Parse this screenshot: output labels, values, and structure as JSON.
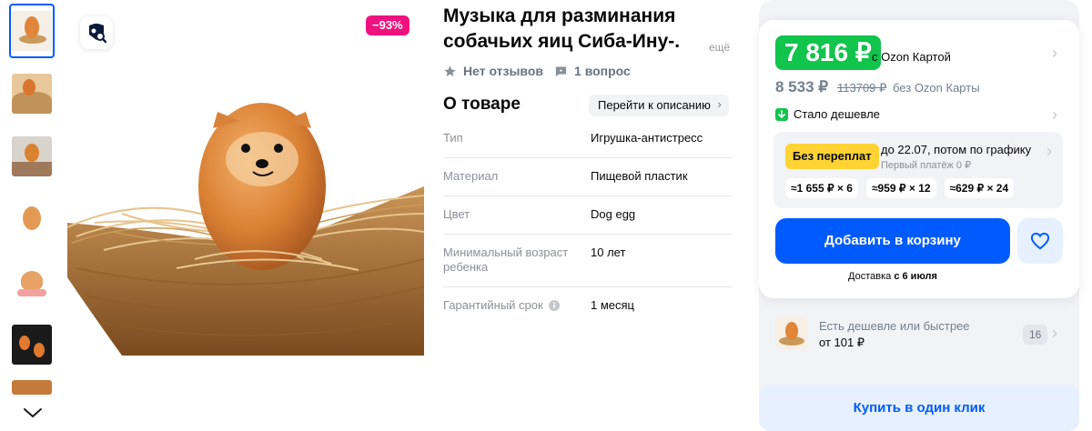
{
  "gallery": {
    "thumbnails": [
      "thumb-1",
      "thumb-2",
      "thumb-3",
      "thumb-4",
      "thumb-5",
      "thumb-6",
      "thumb-7"
    ],
    "discount": "−93%"
  },
  "product": {
    "title_line1": "Музыка для разминания",
    "title_line2": "собачьих яиц Сиба-Ину-.",
    "more": "ещё",
    "reviews": "Нет отзывов",
    "questions": "1 вопрос"
  },
  "about": {
    "heading": "О товаре",
    "goto_description": "Перейти к описанию",
    "specs": [
      {
        "key": "Тип",
        "value": "Игрушка-антистресс"
      },
      {
        "key": "Материал",
        "value": "Пищевой пластик"
      },
      {
        "key": "Цвет",
        "value": "Dog egg"
      },
      {
        "key": "Минимальный возраст ребенка",
        "value": "10 лет"
      },
      {
        "key": "Гарантийный срок",
        "value": "1 месяц"
      }
    ]
  },
  "buybox": {
    "price_card": "7 816 ₽",
    "with_card_label": "с Ozon Картой",
    "price": "8 533 ₽",
    "price_old": "113709 ₽",
    "without_card_label": "без Ozon Карты",
    "cheaper_label": "Стало дешевле",
    "no_overpay_badge": "Без переплат",
    "installment_text": "до 22.07, потом по графику",
    "first_payment": "Первый платёж 0 ₽",
    "installments": [
      "≈1 655 ₽ × 6",
      "≈959 ₽ × 12",
      "≈629 ₽ × 24"
    ],
    "cart_button": "Добавить в корзину",
    "delivery_prefix": "Доставка",
    "delivery_date": "с 6 июля",
    "alt_text": "Есть дешевле или быстрее",
    "alt_price": "от 101 ₽",
    "alt_count": "16",
    "one_click": "Купить в один клик"
  },
  "colors": {
    "accent": "#005bff",
    "price_green": "#10c44c",
    "discount_pink": "#f1117e",
    "badge_yellow": "#ffd334"
  }
}
